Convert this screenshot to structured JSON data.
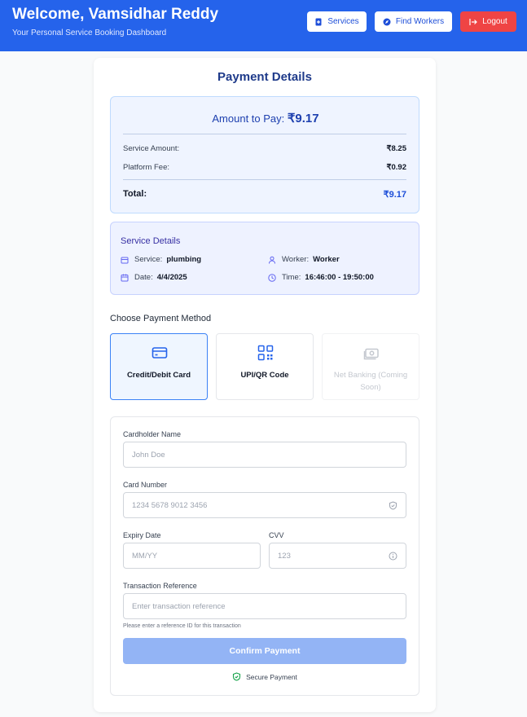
{
  "header": {
    "welcome": "Welcome, Vamsidhar Reddy",
    "subtitle": "Your Personal Service Booking Dashboard",
    "services_label": "Services",
    "find_workers_label": "Find Workers",
    "logout_label": "Logout"
  },
  "payment": {
    "title": "Payment Details",
    "amount_prefix": "Amount to Pay: ",
    "amount": "₹9.17",
    "service_amount_label": "Service Amount:",
    "service_amount": "₹8.25",
    "platform_fee_label": "Platform Fee:",
    "platform_fee": "₹0.92",
    "total_label": "Total:",
    "total": "₹9.17"
  },
  "service_details": {
    "title": "Service Details",
    "service_label": "Service:",
    "service": "plumbing",
    "worker_label": "Worker:",
    "worker": "Worker",
    "date_label": "Date:",
    "date": "4/4/2025",
    "time_label": "Time:",
    "time": "16:46:00 - 19:50:00"
  },
  "methods": {
    "title": "Choose Payment Method",
    "card": "Credit/Debit Card",
    "upi": "UPI/QR Code",
    "netbanking": "Net Banking (Coming Soon)"
  },
  "form": {
    "cardholder_label": "Cardholder Name",
    "cardholder_placeholder": "John Doe",
    "card_number_label": "Card Number",
    "card_number_placeholder": "1234 5678 9012 3456",
    "expiry_label": "Expiry Date",
    "expiry_placeholder": "MM/YY",
    "cvv_label": "CVV",
    "cvv_placeholder": "123",
    "ref_label": "Transaction Reference",
    "ref_placeholder": "Enter transaction reference",
    "ref_help": "Please enter a reference ID for this transaction",
    "confirm_label": "Confirm Payment",
    "secure_label": "Secure Payment"
  },
  "colors": {
    "header_bg": "#2563eb",
    "accent": "#1d4ed8",
    "logout": "#ef4444",
    "confirm_disabled": "#93b4f5"
  }
}
